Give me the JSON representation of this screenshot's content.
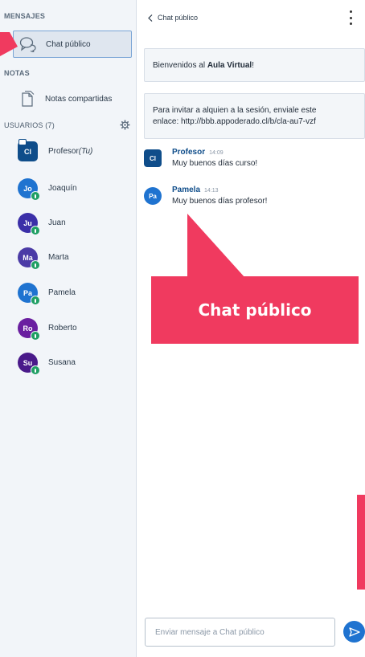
{
  "sidebar": {
    "messages_title": "MENSAJES",
    "public_chat_label": "Chat público",
    "notes_title": "NOTAS",
    "shared_notes_label": "Notas compartidas",
    "users_title": "USUARIOS (7)",
    "users": [
      {
        "initials": "Cl",
        "name": "Profesor",
        "suffix": "(Tu)",
        "color": "#0f4d8a",
        "role": "moderator"
      },
      {
        "initials": "Jo",
        "name": "Joaquín",
        "color": "#1f73d0"
      },
      {
        "initials": "Ju",
        "name": "Juan",
        "color": "#3b2fa8"
      },
      {
        "initials": "Ma",
        "name": "Marta",
        "color": "#4b3ba6"
      },
      {
        "initials": "Pa",
        "name": "Pamela",
        "color": "#1f73d0"
      },
      {
        "initials": "Ro",
        "name": "Roberto",
        "color": "#6a1fa0"
      },
      {
        "initials": "Su",
        "name": "Susana",
        "color": "#4a1a8a"
      }
    ]
  },
  "chat": {
    "back_label": "Chat público",
    "welcome_prefix": "Bienvenidos al ",
    "welcome_strong": "Aula Virtual",
    "welcome_suffix": "!",
    "invite_line1": "Para invitar a alquien a la sesión, enviale este",
    "invite_line2": "enlace: http://bbb.appoderado.cl/b/cla-au7-vzf",
    "messages": [
      {
        "initials": "Cl",
        "author": "Profesor",
        "time": "14:09",
        "text": "Muy buenos días curso!",
        "color": "#0f4d8a",
        "shape": "square"
      },
      {
        "initials": "Pa",
        "author": "Pamela",
        "time": "14:13",
        "text": "Muy buenos días profesor!",
        "color": "#1f73d0",
        "shape": "circle"
      }
    ],
    "input_placeholder": "Enviar mensaje a Chat público"
  },
  "annotation": {
    "callout_text": "Chat público",
    "color": "#f03a5f"
  }
}
